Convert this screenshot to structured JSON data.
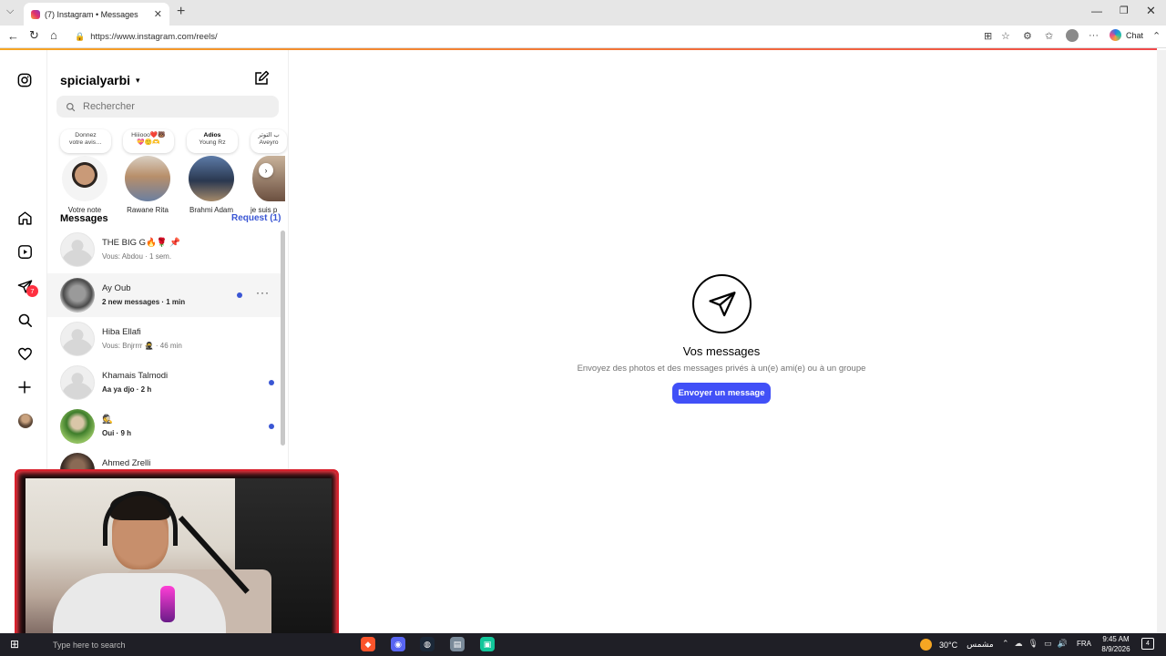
{
  "browser": {
    "tab_title": "(7) Instagram • Messages",
    "url": "https://www.instagram.com/reels/",
    "copilot_label": "Chat"
  },
  "inbox": {
    "username": "spicialyarbi",
    "search_placeholder": "Rechercher",
    "notes": [
      {
        "bubble_line1": "Donnez",
        "bubble_line2": "votre avis…",
        "name": "Votre note"
      },
      {
        "bubble_line1": "Hiiiooo❤️🐻",
        "bubble_line2": "💝🙂🫶",
        "name": "Rawane Rita"
      },
      {
        "bubble_line1": "Adios",
        "bubble_line2": "Young Rz",
        "name": "Brahmi Adam"
      },
      {
        "bubble_line1": "ب التوتر",
        "bubble_line2": "Aveyro",
        "name": "je suis p"
      }
    ],
    "messages_title": "Messages",
    "requests_label": "Request (1)",
    "conversations": [
      {
        "name": "THE BIG G🔥🌹 📌",
        "preview": "Vous: Abdou · 1 sem.",
        "unread": false
      },
      {
        "name": "Ay Oub",
        "preview": "2 new messages · 1 min",
        "unread": true
      },
      {
        "name": "Hiba Ellafi",
        "preview": "Vous: Bnjrrrr 🥷 · 46 min",
        "unread": false
      },
      {
        "name": "Khamais Talmodi",
        "preview": "Aa ya djo · 2 h",
        "unread": true
      },
      {
        "name": "🕵️",
        "preview": "Oui · 9 h",
        "unread": true
      },
      {
        "name": "Ahmed Zrelli",
        "preview": "",
        "unread": false
      }
    ]
  },
  "nav": {
    "messages_badge": "7"
  },
  "main": {
    "title": "Vos messages",
    "subtitle": "Envoyez des photos et des messages privés à un(e) ami(e) ou à un groupe",
    "button_label": "Envoyer un message"
  },
  "taskbar": {
    "search_placeholder": "Type here to search",
    "weather": "30°C",
    "weather_desc": "مشمس",
    "language": "FRA",
    "time": "9:45 AM",
    "date": "8/9/2026"
  },
  "colors": {
    "accent": "#4150f7",
    "link": "#3a56d4",
    "badge": "#ff3040",
    "webcam_border": "#d8202c"
  }
}
